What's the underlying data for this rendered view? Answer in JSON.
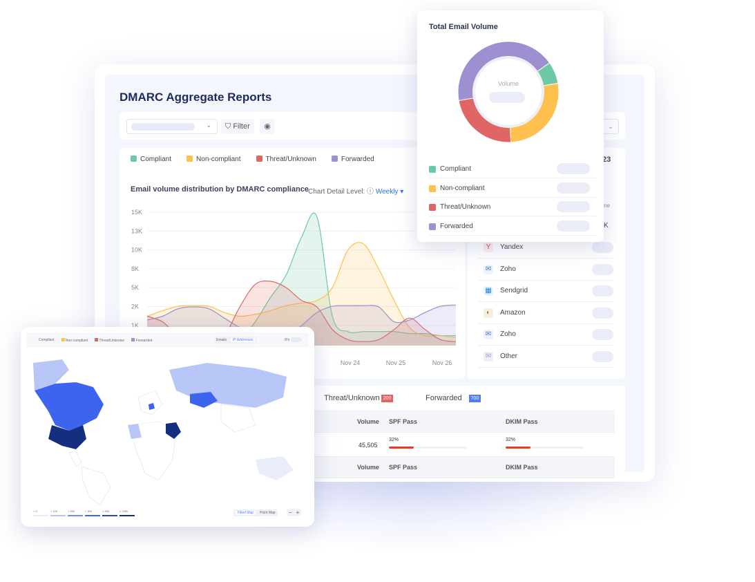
{
  "page": {
    "title": "DMARC Aggregate Reports",
    "filter_label": "Filter",
    "partial_value": "23"
  },
  "legend": [
    {
      "label": "Compliant",
      "color": "#6cc9a1"
    },
    {
      "label": "Non-compliant",
      "color": "#ffc04d"
    },
    {
      "label": "Threat/Unknown",
      "color": "#e06666"
    },
    {
      "label": "Forwarded",
      "color": "#9d8fd0"
    }
  ],
  "chart": {
    "title": "Email volume distribution by DMARC compliance",
    "detail_label": "Chart Detail Level:",
    "detail_value": "Weekly"
  },
  "chart_data": {
    "type": "area",
    "y_ticks": [
      "15K",
      "13K",
      "10K",
      "8K",
      "5K",
      "2K",
      "1K"
    ],
    "x_ticks": [
      "Nov 24",
      "Nov 25",
      "Nov 26"
    ],
    "unit": "K",
    "series": [
      {
        "name": "Compliant",
        "color": "#6cc9a1",
        "values": [
          0.2,
          0.2,
          0.2,
          0.2,
          0.2,
          0.2,
          0.3,
          1.2,
          3.5,
          7,
          12,
          14.5,
          1.5,
          0.7,
          0.7,
          0.7,
          0.7,
          0.6,
          0.6,
          0.5,
          0.5
        ]
      },
      {
        "name": "Non-compliant",
        "color": "#ffc04d",
        "values": [
          1.5,
          1.8,
          2.1,
          2.2,
          2.1,
          1.7,
          1.5,
          1.6,
          1.8,
          2.2,
          2.6,
          3,
          5,
          10,
          11,
          8,
          3,
          0.9,
          0.5,
          0.5,
          0.4
        ]
      },
      {
        "name": "Threat/Unknown",
        "color": "#e06666",
        "values": [
          1.5,
          1.2,
          0.5,
          0.3,
          0.3,
          0.5,
          2,
          5.5,
          6,
          5,
          3,
          2,
          0.8,
          0.3,
          0.2,
          0.3,
          0.8,
          1.4,
          0.8,
          0.3,
          0.2
        ]
      },
      {
        "name": "Forwarded",
        "color": "#9d8fd0",
        "values": [
          1.3,
          1.5,
          1.9,
          2,
          1.9,
          1.4,
          0.9,
          0.5,
          0.4,
          0.5,
          1,
          1.7,
          2.1,
          2.2,
          2.2,
          2,
          1.2,
          1.3,
          1.7,
          2.1,
          2.3
        ]
      }
    ]
  },
  "providers": {
    "col_partial": "ne",
    "value_partial": "K",
    "items": [
      {
        "name": "Yandex",
        "icon": "yandex-icon"
      },
      {
        "name": "Zoho",
        "icon": "zoho-icon"
      },
      {
        "name": "Sendgrid",
        "icon": "sendgrid-icon"
      },
      {
        "name": "Amazon",
        "icon": "amazon-icon"
      },
      {
        "name": "Zoho",
        "icon": "zoho-icon"
      },
      {
        "name": "Other",
        "icon": "mail-icon"
      }
    ]
  },
  "table": {
    "tabs": [
      {
        "label": "Threat/Unknown",
        "count": "200",
        "color": "#e06666"
      },
      {
        "label": "Forwarded",
        "count": "700",
        "color": "#4f7bff"
      }
    ],
    "headers": [
      "Volume",
      "SPF Pass",
      "DKIM Pass"
    ],
    "rows": [
      {
        "volume": "45,505",
        "spf": "32%",
        "dkim": "32%",
        "spf_value": 32,
        "dkim_value": 32
      }
    ]
  },
  "donut": {
    "title": "Total Email Volume",
    "center_label": "Volume",
    "segments": [
      {
        "label": "Forwarded",
        "value": 43,
        "color": "#9d8fd0"
      },
      {
        "label": "Compliant",
        "value": 7,
        "color": "#6cc9a1"
      },
      {
        "label": "Non-compliant",
        "value": 27,
        "color": "#ffc04d"
      },
      {
        "label": "Threat/Unknown",
        "value": 23,
        "color": "#e06666"
      }
    ],
    "rows": [
      {
        "label": "Compliant",
        "color": "#6cc9a1"
      },
      {
        "label": "Non-compliant",
        "color": "#ffc04d"
      },
      {
        "label": "Threat/Unknown",
        "color": "#e06666"
      },
      {
        "label": "Forwarded",
        "color": "#9d8fd0"
      }
    ]
  },
  "map": {
    "legend": [
      "Compliant",
      "Non-compliant",
      "Threat/Unknown",
      "Forwarded"
    ],
    "toggle": [
      "Emails",
      "IP Addresses"
    ],
    "ips_label": "IPs",
    "scale": [
      "< 0",
      "< 100",
      "< 200",
      "< 300",
      "< 500",
      "< 1000"
    ],
    "scale_colors": [
      "#e8ecfb",
      "#b8c6f7",
      "#6f8ff5",
      "#3d64ee",
      "#2548c4",
      "#152f80"
    ],
    "view": [
      "Filled Map",
      "Point Map"
    ],
    "zoom_out": "−",
    "zoom_in": "+"
  }
}
